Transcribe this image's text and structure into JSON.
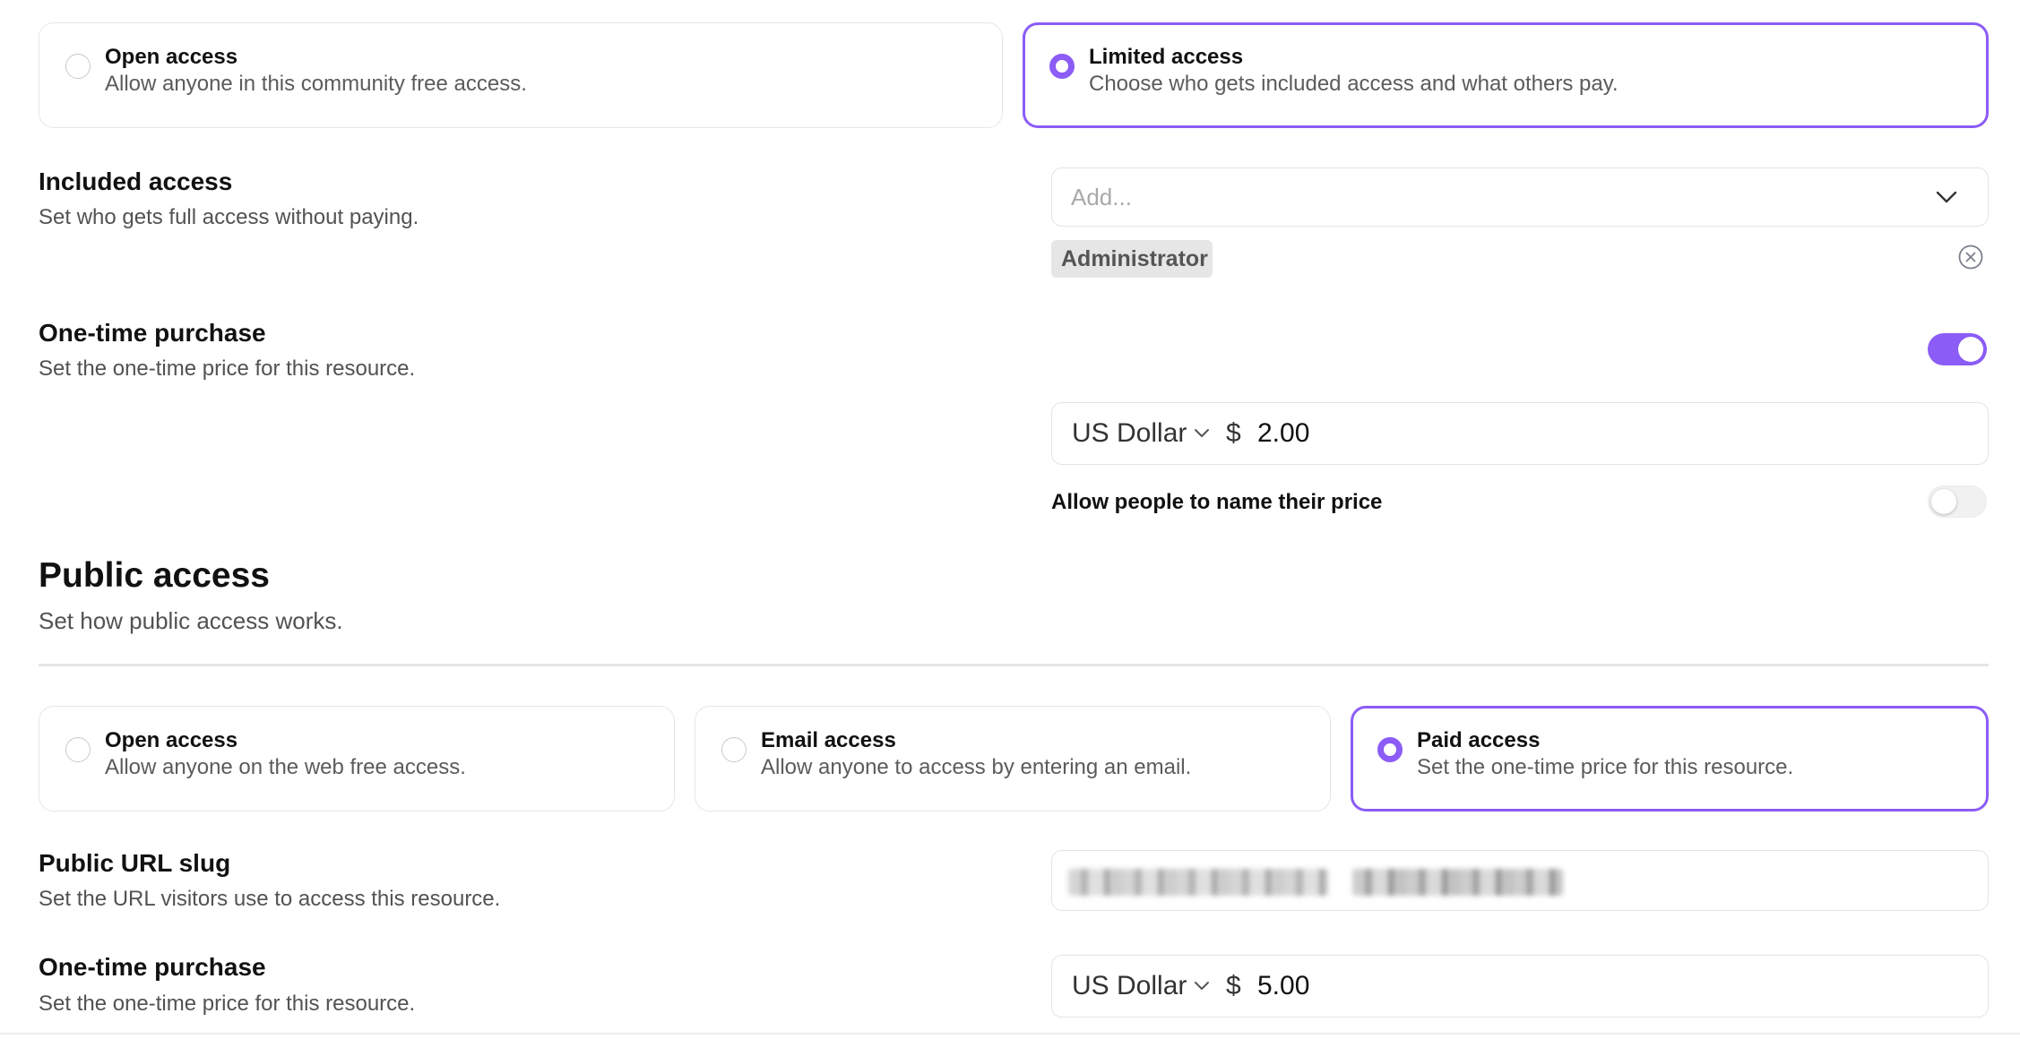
{
  "member_access": {
    "options": [
      {
        "title": "Open access",
        "description": "Allow anyone in this community free access.",
        "selected": false
      },
      {
        "title": "Limited access",
        "description": "Choose who gets included access and what others pay.",
        "selected": true
      }
    ]
  },
  "included_access": {
    "title": "Included access",
    "description": "Set who gets full access without paying.",
    "placeholder": "Add...",
    "chips": [
      "Administrator"
    ]
  },
  "one_time_purchase": {
    "title": "One-time purchase",
    "description": "Set the one-time price for this resource.",
    "enabled": true,
    "currency": "US Dollar",
    "symbol": "$",
    "price": "2.00",
    "name_price_label": "Allow people to name their price",
    "name_price_enabled": false
  },
  "public_access": {
    "title": "Public access",
    "description": "Set how public access works.",
    "options": [
      {
        "title": "Open access",
        "description": "Allow anyone on the web free access.",
        "selected": false
      },
      {
        "title": "Email access",
        "description": "Allow anyone to access by entering an email.",
        "selected": false
      },
      {
        "title": "Paid access",
        "description": "Set the one-time price for this resource.",
        "selected": true
      }
    ]
  },
  "public_url": {
    "title": "Public URL slug",
    "description": "Set the URL visitors use to access this resource."
  },
  "public_purchase": {
    "title": "One-time purchase",
    "description": "Set the one-time price for this resource.",
    "currency": "US Dollar",
    "symbol": "$",
    "price": "5.00"
  },
  "colors": {
    "accent": "#8b5cf6",
    "border": "#e3e3e3",
    "muted_text": "#525252"
  }
}
